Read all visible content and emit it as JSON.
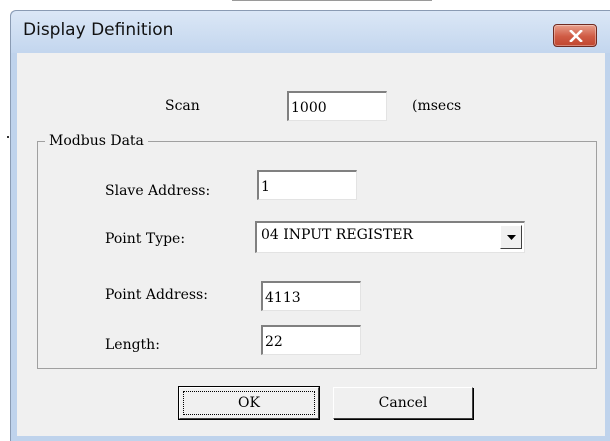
{
  "dialog": {
    "title": "Display Definition",
    "close_icon": "close-icon"
  },
  "scan": {
    "label": "Scan",
    "value": "1000",
    "unit": "(msecs"
  },
  "modbus": {
    "group_label": "Modbus Data",
    "slave_address": {
      "label": "Slave Address:",
      "value": "1"
    },
    "point_type": {
      "label": "Point Type:",
      "value": "04 INPUT REGISTER",
      "dropdown_icon": "chevron-down-icon"
    },
    "point_address": {
      "label": "Point Address:",
      "value": "4113"
    },
    "length": {
      "label": "Length:",
      "value": "22"
    }
  },
  "buttons": {
    "ok": "OK",
    "cancel": "Cancel"
  },
  "colors": {
    "frame": "#bfd3ec",
    "client": "#f0f0f0",
    "close_button": "#cf5b44"
  }
}
